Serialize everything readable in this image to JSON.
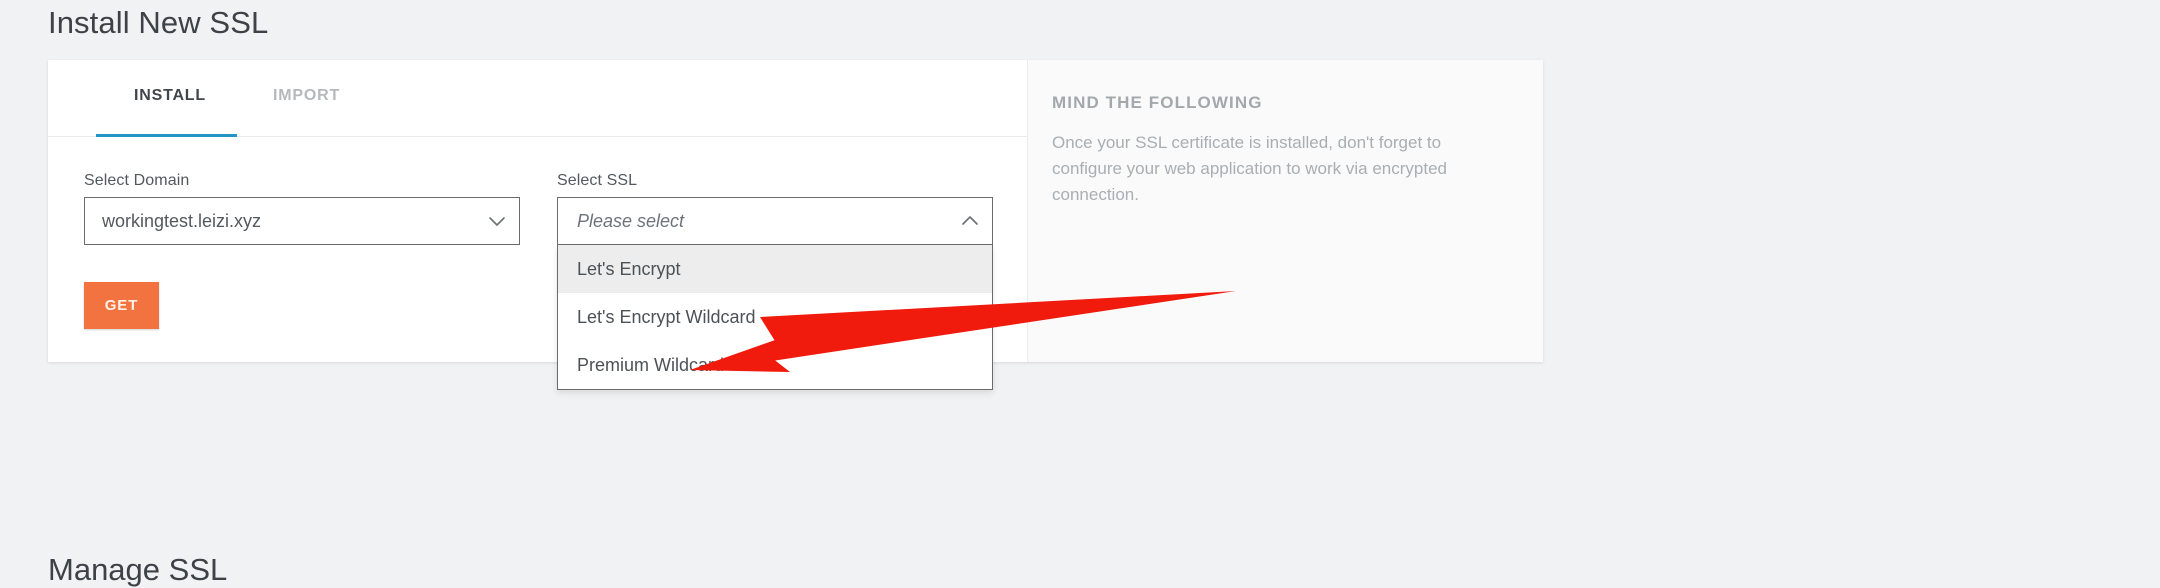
{
  "page": {
    "title": "Install New SSL",
    "next_section_title": "Manage SSL"
  },
  "tabs": [
    {
      "label": "INSTALL",
      "active": true
    },
    {
      "label": "IMPORT",
      "active": false
    }
  ],
  "form": {
    "domain": {
      "label": "Select Domain",
      "value": "workingtest.leizi.xyz",
      "chevron_icon": "chevron-down-icon"
    },
    "ssl": {
      "label": "Select SSL",
      "placeholder": "Please select",
      "chevron_icon": "chevron-up-icon",
      "expanded": true,
      "options": [
        {
          "label": "Let's Encrypt",
          "highlighted": true
        },
        {
          "label": "Let's Encrypt Wildcard",
          "highlighted": false
        },
        {
          "label": "Premium Wildcard",
          "highlighted": false
        }
      ]
    },
    "submit_label": "GET"
  },
  "info_panel": {
    "title": "MIND THE FOLLOWING",
    "body": "Once your SSL certificate is installed, don't forget to configure your web application to work via encrypted connection."
  },
  "annotation": {
    "type": "arrow",
    "color": "#f01a0d",
    "points_to": "Let's Encrypt"
  },
  "colors": {
    "accent_tab": "#2196c4",
    "button": "#f2733f",
    "page_bg": "#f1f2f3",
    "card_bg": "#ffffff",
    "info_panel_bg": "#fafafa",
    "arrow": "#f01a0d"
  }
}
